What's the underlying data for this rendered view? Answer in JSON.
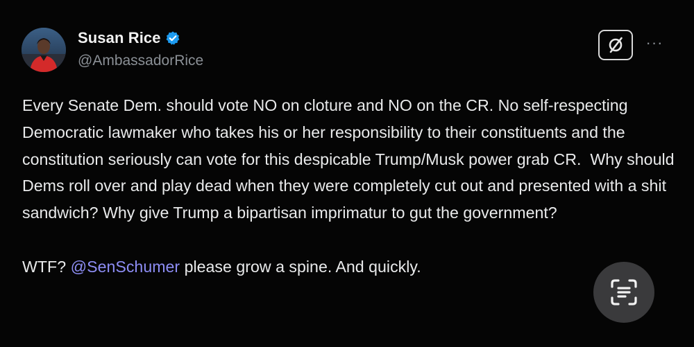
{
  "author": {
    "display_name": "Susan Rice",
    "handle": "@AmbassadorRice",
    "verified_icon": "verified-badge-icon"
  },
  "tweet": {
    "paragraph1": "Every Senate Dem. should vote NO on cloture and NO on the CR. No self-respecting Democratic lawmaker who takes his or her responsibility to their constituents and the constitution seriously can vote for this despicable Trump/Musk power grab CR.  Why should Dems roll over and play dead when they were completely cut out and presented with a shit sandwich? Why give Trump a bipartisan imprimatur to gut the government?",
    "paragraph2_start": "WTF? ",
    "mention": "@SenSchumer",
    "paragraph2_end": " please grow a spine. And quickly."
  },
  "controls": {
    "grok_icon": "grok-icon",
    "more_icon": "more-horizontal-icon",
    "more_label": "···",
    "scan_icon": "text-scan-icon"
  },
  "colors": {
    "background": "#050505",
    "text": "#e9eaeb",
    "handle": "#8b9096",
    "mention": "#8d8df4",
    "verified": "#1d9bf0",
    "scan_button_bg": "#3a3a3c"
  }
}
